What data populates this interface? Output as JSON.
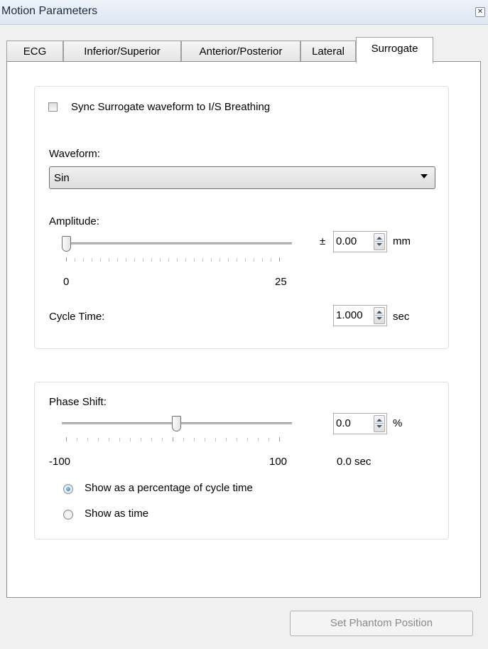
{
  "window": {
    "title": "Motion Parameters"
  },
  "tabs": [
    {
      "label": "ECG"
    },
    {
      "label": "Inferior/Superior"
    },
    {
      "label": "Anterior/Posterior"
    },
    {
      "label": "Lateral"
    },
    {
      "label": "Surrogate",
      "active": true
    }
  ],
  "sync": {
    "label": "Sync Surrogate waveform to I/S Breathing",
    "checked": false
  },
  "waveform": {
    "label": "Waveform:",
    "selected": "Sin"
  },
  "amplitude": {
    "label": "Amplitude:",
    "slider_value": 0,
    "min_label": "0",
    "max_label": "25",
    "plusminus": "±",
    "value": "0.00",
    "unit": "mm"
  },
  "cycle_time": {
    "label": "Cycle Time:",
    "value": "1.000",
    "unit": "sec"
  },
  "phase_shift": {
    "label": "Phase Shift:",
    "slider_value": 0,
    "min_label": "-100",
    "max_label": "100",
    "value": "0.0",
    "unit": "%",
    "time_readout": "0.0 sec"
  },
  "display_mode": {
    "options": [
      {
        "label": "Show as a percentage of cycle time",
        "selected": true
      },
      {
        "label": "Show as time",
        "selected": false
      }
    ]
  },
  "buttons": {
    "set_phantom_position": "Set Phantom Position"
  },
  "colors": {
    "radio_accent": "#1a6fc2",
    "disabled_text": "#8a8a8a",
    "panel_border": "#8e8f8f"
  }
}
